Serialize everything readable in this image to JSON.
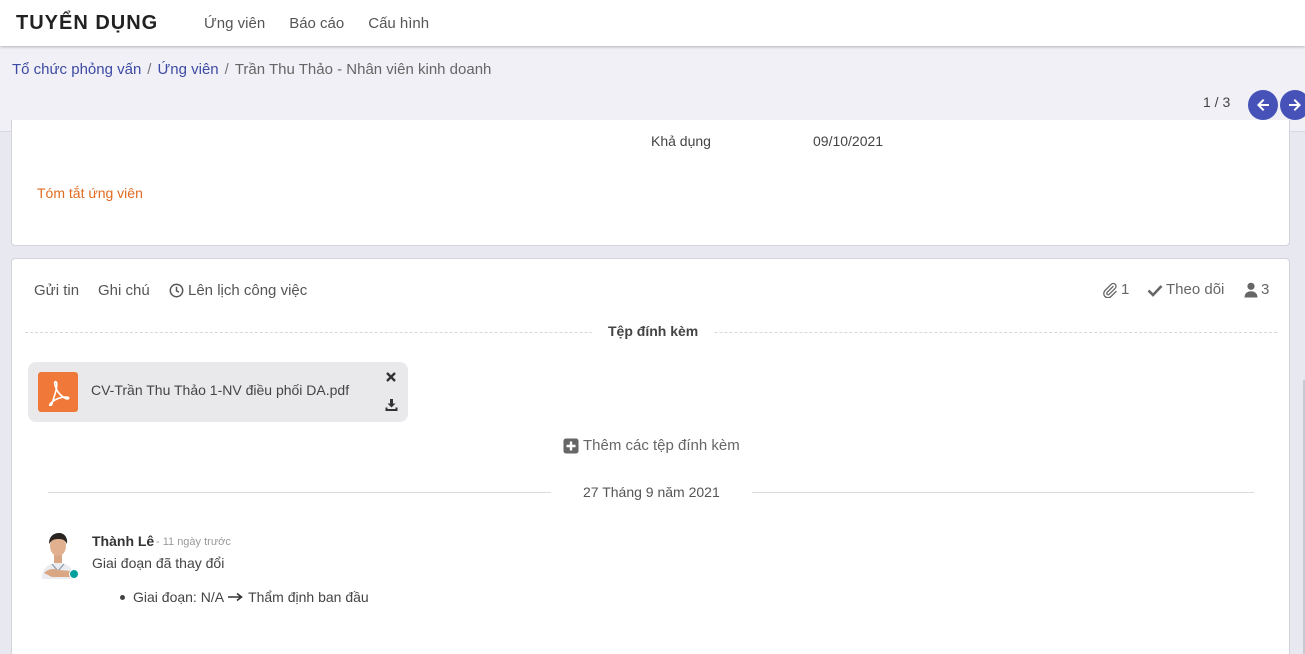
{
  "app": {
    "brand": "TUYỂN DỤNG",
    "menu": [
      "Ứng viên",
      "Báo cáo",
      "Cấu hình"
    ]
  },
  "breadcrumb": {
    "items": [
      "Tổ chức phỏng vấn",
      "Ứng viên"
    ],
    "current": "Trần Thu Thảo - Nhân viên kinh doanh"
  },
  "pager": {
    "value": "1 / 3"
  },
  "form": {
    "availability_label": "Khả dụng",
    "availability_value": "09/10/2021",
    "summary_label": "Tóm tắt ứng viên"
  },
  "chatter": {
    "send_message": "Gửi tin",
    "log_note": "Ghi chú",
    "schedule_activity": "Lên lịch công việc",
    "attachment_count": "1",
    "follow_label": "Theo dõi",
    "follower_count": "3",
    "attachments_title": "Tệp đính kèm",
    "attachment_name": "CV-Trần Thu Thảo 1-NV điều phối DA.pdf",
    "add_attachments": "Thêm các tệp đính kèm",
    "date_separator": "27 Tháng 9 năm 2021",
    "message": {
      "author": "Thành Lê",
      "time": "- 11 ngày trước",
      "body": "Giai đoạn đã thay đổi",
      "change_field": "Giai đoạn:",
      "change_old": "N/A",
      "change_new": "Thẩm định ban đầu"
    }
  },
  "colors": {
    "accent": "#4652b8",
    "link": "#3d4aa3",
    "summary": "#e06b22",
    "pdf": "#f0793a",
    "online": "#00a09d"
  },
  "icons": [
    "clock-icon",
    "paperclip-icon",
    "check-icon",
    "user-icon",
    "close-icon",
    "download-icon",
    "plus-square-icon",
    "pdf-icon",
    "arrow-left-icon",
    "arrow-right-icon"
  ]
}
